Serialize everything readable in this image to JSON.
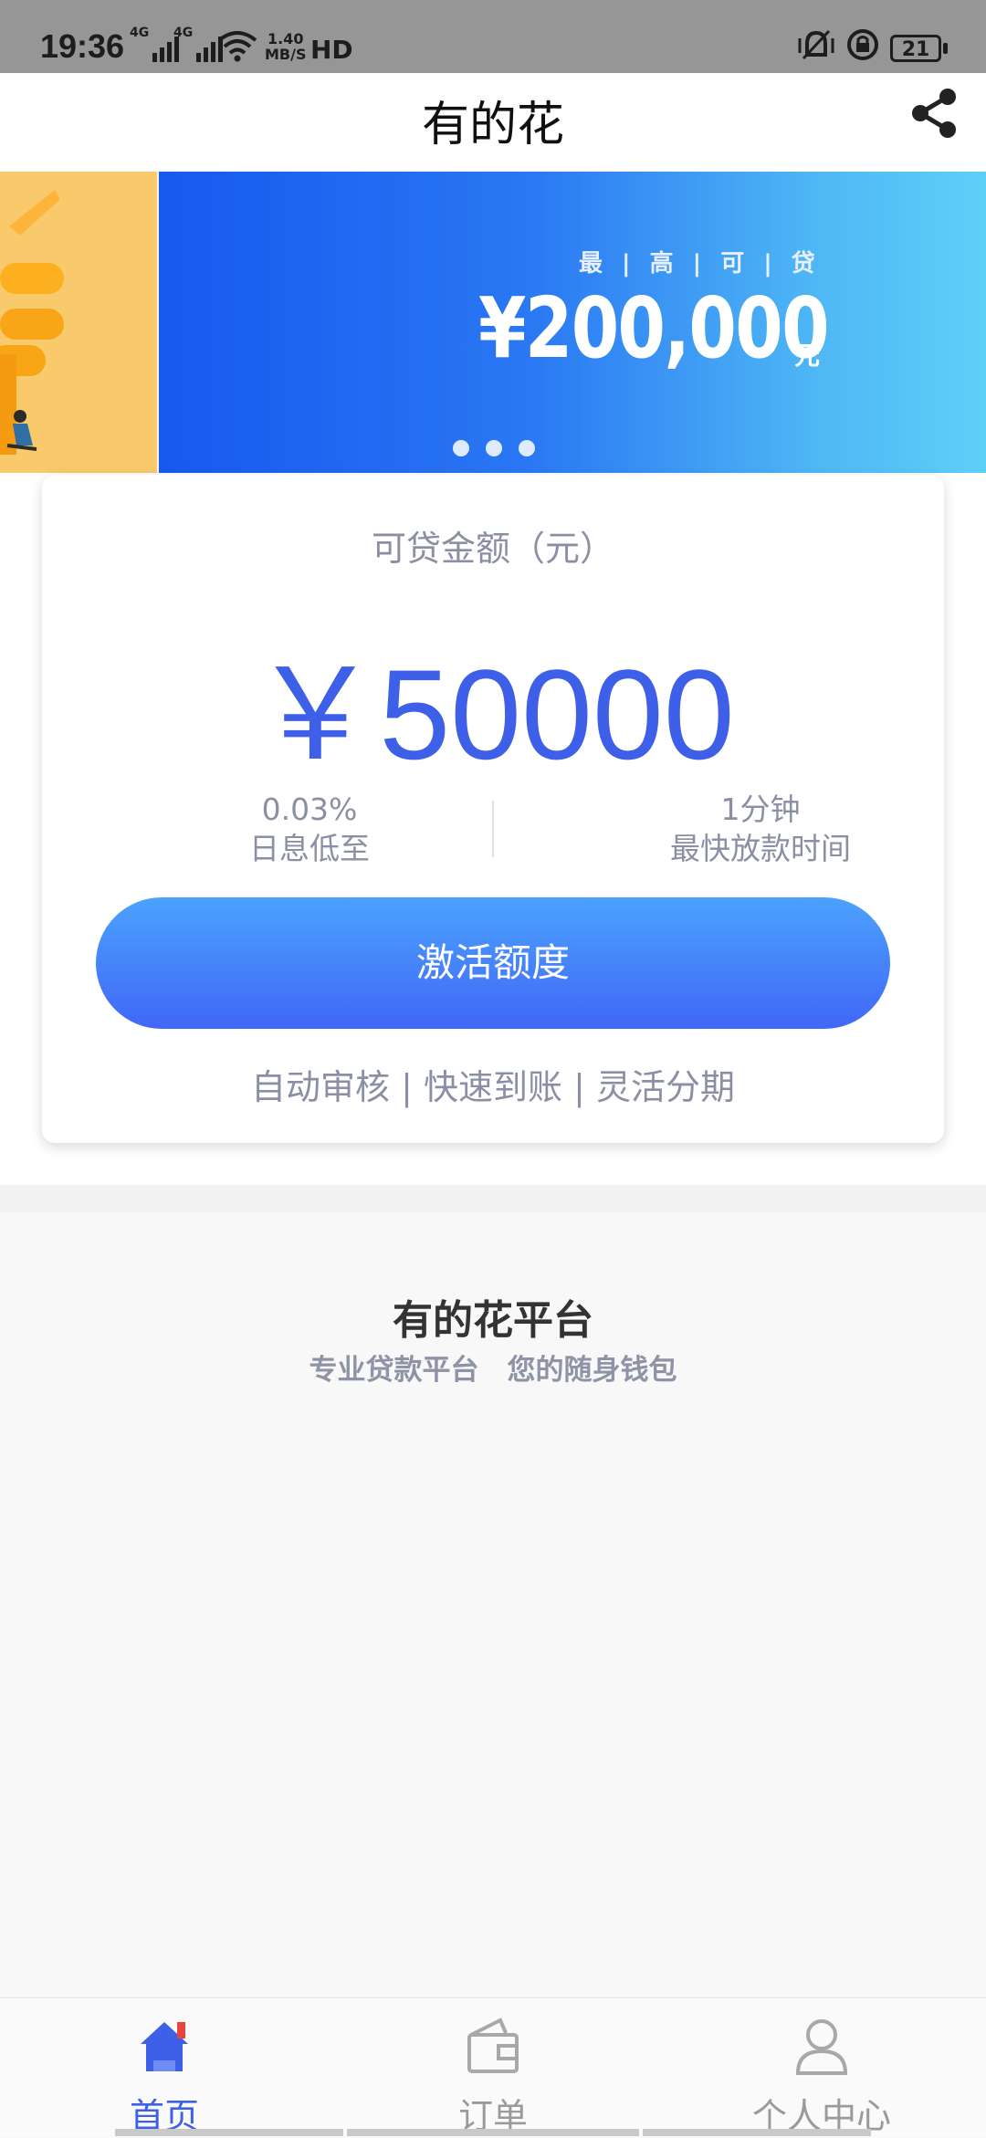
{
  "status_bar": {
    "time": "19:36",
    "signal1_label": "4G",
    "signal2_label": "4G",
    "speed_value": "1.40",
    "speed_unit": "MB/S",
    "hd_label": "HD",
    "battery": "21"
  },
  "header": {
    "title": "有的花",
    "share_icon": "share-icon"
  },
  "banner": {
    "subtitle": "最 | 高 | 可 | 贷",
    "amount": "¥200,000",
    "unit": "元",
    "slide_count": 3
  },
  "loan_card": {
    "label": "可贷金额（元）",
    "amount": "￥50000",
    "stats": [
      {
        "value": "0.03%",
        "label": "日息低至"
      },
      {
        "value": "1分钟",
        "label": "最快放款时间"
      }
    ],
    "button_label": "激活额度",
    "features": "自动审核 | 快速到账 | 灵活分期"
  },
  "platform": {
    "title": "有的花平台",
    "slogan": "专业贷款平台　您的随身钱包"
  },
  "bottom_nav": {
    "items": [
      {
        "label": "首页",
        "icon": "home-icon",
        "active": true
      },
      {
        "label": "订单",
        "icon": "wallet-icon",
        "active": false
      },
      {
        "label": "个人中心",
        "icon": "user-icon",
        "active": false
      }
    ],
    "active_color": "#3e5fe8",
    "inactive_color": "#9a9a9a"
  }
}
